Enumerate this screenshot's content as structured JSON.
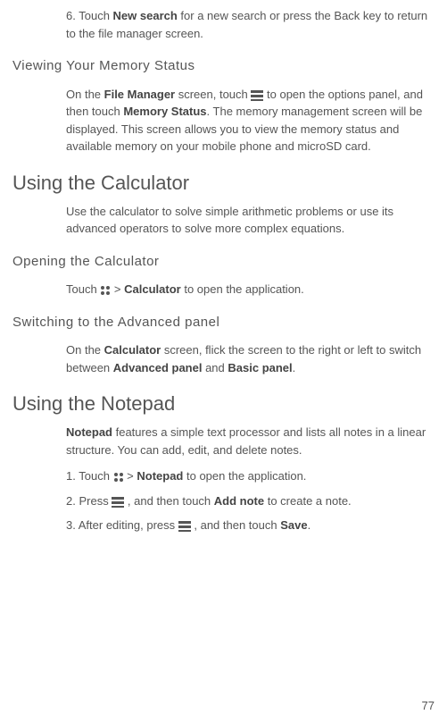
{
  "page_number": "77",
  "top_item": {
    "num": "6.",
    "pre": "Touch ",
    "bold": "New search",
    "post": " for a new search or press the Back key to return to the file manager screen."
  },
  "viewing_memory": {
    "heading": "Viewing Your Memory Status",
    "p_pre1": "On the ",
    "p_b1": "File Manager",
    "p_mid1": " screen, touch ",
    "p_mid2": " to open the options panel, and then touch ",
    "p_b2": "Memory Status",
    "p_post": ". The memory management screen will be displayed. This screen allows you to view the memory status and available memory on your mobile phone and microSD card."
  },
  "using_calculator": {
    "heading": "Using the Calculator",
    "intro": "Use the calculator to solve simple arithmetic problems or use its advanced operators to solve more complex equations.",
    "opening": {
      "heading": "Opening the Calculator",
      "pre": "Touch ",
      "mid": " > ",
      "bold": "Calculator",
      "post": " to open the application."
    },
    "switching": {
      "heading": "Switching to the Advanced panel",
      "pre": "On the ",
      "b1": "Calculator",
      "mid1": " screen, flick the screen to the right or left to switch between ",
      "b2": "Advanced panel",
      "mid2": " and ",
      "b3": "Basic panel",
      "post": "."
    }
  },
  "using_notepad": {
    "heading": "Using the Notepad",
    "intro_b": "Notepad",
    "intro_post": " features a simple text processor and lists all notes in a linear structure. You can add, edit, and delete notes.",
    "step1": {
      "num": "1.",
      "pre": "Touch ",
      "mid": " > ",
      "bold": "Notepad",
      "post": " to open the application."
    },
    "step2": {
      "num": "2.",
      "pre": "Press ",
      "mid": " , and then touch ",
      "bold": "Add note",
      "post": " to create a note."
    },
    "step3": {
      "num": "3.",
      "pre": "After editing, press ",
      "mid": " , and then touch ",
      "bold": "Save",
      "post": "."
    }
  }
}
